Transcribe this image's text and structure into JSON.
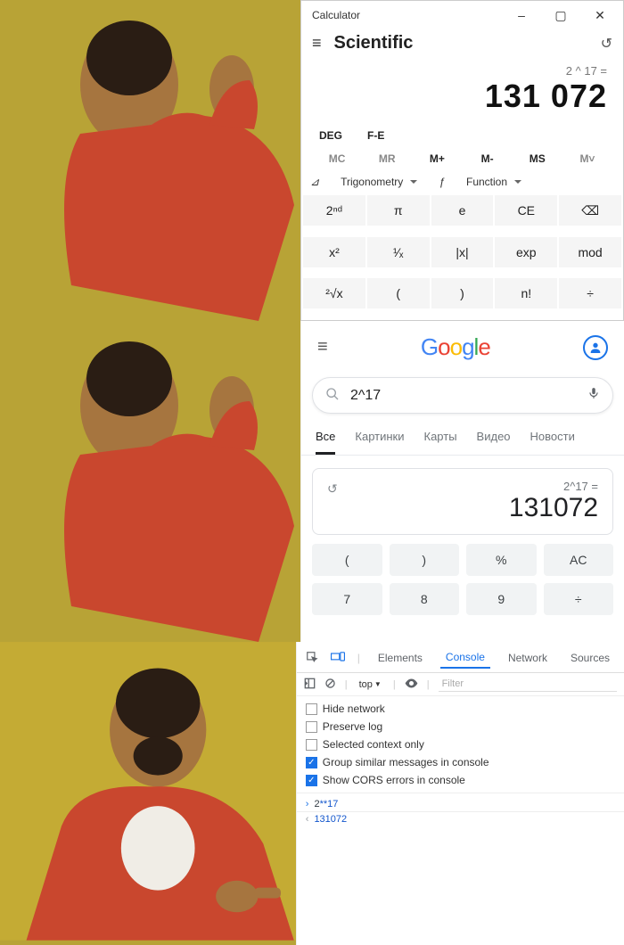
{
  "calculator": {
    "title": "Calculator",
    "mode": "Scientific",
    "equation": "2 ^ 17 =",
    "result": "131 072",
    "deg": "DEG",
    "fe": "F-E",
    "memory": [
      "MC",
      "MR",
      "M+",
      "M-",
      "MS",
      "M˅"
    ],
    "trig": "Trigonometry",
    "func": "Function",
    "keys": [
      "2ⁿᵈ",
      "π",
      "e",
      "CE",
      "⌫",
      "x²",
      "¹⁄ₓ",
      "|x|",
      "exp",
      "mod",
      "²√x",
      "(",
      ")",
      "n!",
      "÷"
    ]
  },
  "google": {
    "logo": {
      "g1": "G",
      "o1": "o",
      "o2": "o",
      "g2": "g",
      "l": "l",
      "e": "e"
    },
    "query": "2^17",
    "tabs": [
      "Все",
      "Картинки",
      "Карты",
      "Видео",
      "Новости"
    ],
    "calc_eq": "2^17 =",
    "calc_result": "131072",
    "buttons_r1": [
      "(",
      ")",
      "%",
      "AC"
    ],
    "buttons_r2": [
      "7",
      "8",
      "9",
      "÷"
    ]
  },
  "devtools": {
    "tabs": [
      "Elements",
      "Console",
      "Network",
      "Sources"
    ],
    "top_label": "top",
    "filter_placeholder": "Filter",
    "checks": [
      {
        "label": "Hide network",
        "checked": false
      },
      {
        "label": "Preserve log",
        "checked": false
      },
      {
        "label": "Selected context only",
        "checked": false
      },
      {
        "label": "Group similar messages in console",
        "checked": true
      },
      {
        "label": "Show CORS errors in console",
        "checked": true
      }
    ],
    "input_base": "2",
    "input_op": "**",
    "input_arg": "17",
    "output": "131072"
  }
}
